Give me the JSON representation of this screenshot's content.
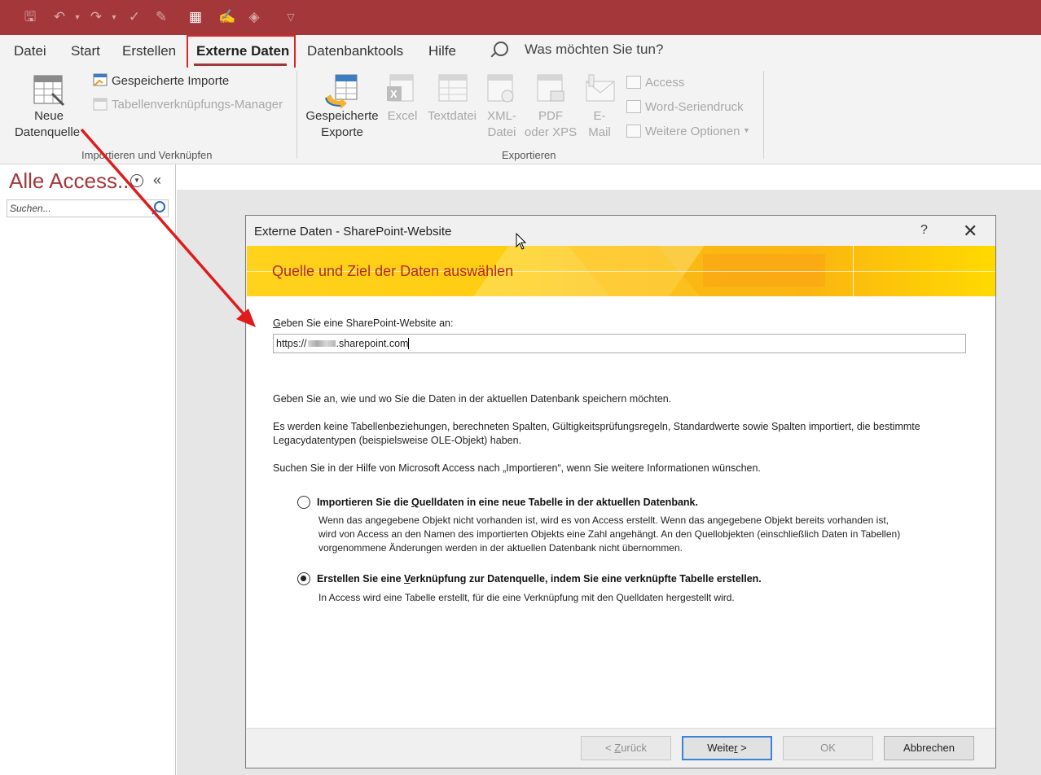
{
  "qat": {
    "icons": [
      "save-icon",
      "undo-icon",
      "redo-icon",
      "check-icon",
      "form-icon",
      "table-icon",
      "brush-icon",
      "fill-icon",
      "customize-qat-icon"
    ]
  },
  "tabs": {
    "datei": "Datei",
    "start": "Start",
    "erstellen": "Erstellen",
    "externe_daten": "Externe Daten",
    "datenbanktools": "Datenbanktools",
    "hilfe": "Hilfe",
    "tell_me": "Was möchten Sie tun?"
  },
  "ribbon": {
    "import_group": {
      "neue_datenquelle_line1": "Neue",
      "neue_datenquelle_line2": "Datenquelle",
      "gespeicherte_importe": "Gespeicherte Importe",
      "tabellenverknuepfungs_manager": "Tabellenverknüpfungs-Manager",
      "label": "Importieren und Verknüpfen"
    },
    "export_group": {
      "gespeicherte_exporte_line1": "Gespeicherte",
      "gespeicherte_exporte_line2": "Exporte",
      "excel": "Excel",
      "textdatei": "Textdatei",
      "xml_line1": "XML-",
      "xml_line2": "Datei",
      "pdf_line1": "PDF",
      "pdf_line2": "oder XPS",
      "email_line1": "E-",
      "email_line2": "Mail",
      "access": "Access",
      "word_seriendruck": "Word-Seriendruck",
      "weitere_optionen": "Weitere Optionen",
      "label": "Exportieren"
    }
  },
  "nav": {
    "title": "Alle Access...",
    "search_placeholder": "Suchen..."
  },
  "dialog": {
    "title": "Externe Daten - SharePoint-Website",
    "help": "?",
    "banner": "Quelle und Ziel der Daten auswählen",
    "site_label_prefix": "G",
    "site_label_rest": "eben Sie eine SharePoint-Website an:",
    "url_prefix": "https://",
    "url_suffix": ".sharepoint.com",
    "info1": "Geben Sie an, wie und wo Sie die Daten in der aktuellen Datenbank speichern möchten.",
    "info2_line1": "Es werden keine Tabellenbeziehungen, berechneten Spalten, Gültigkeitsprüfungsregeln, Standardwerte sowie Spalten importiert, die bestimmte",
    "info2_line2": "Legacydatentypen (beispielsweise OLE-Objekt) haben.",
    "info3": "Suchen Sie in der Hilfe von Microsoft Access nach „Importieren“, wenn Sie weitere Informationen wünschen.",
    "option_import": {
      "title_pre": "Importieren Sie die ",
      "title_ul": "Q",
      "title_post": "uelldaten in eine neue Tabelle in der aktuellen Datenbank.",
      "desc1": "Wenn das angegebene Objekt nicht vorhanden ist, wird es von Access erstellt. Wenn das angegebene Objekt bereits vorhanden ist,",
      "desc2": "wird von Access an den Namen des importierten Objekts eine Zahl angehängt. An den Quellobjekten (einschließlich Daten in Tabellen)",
      "desc3": "vorgenommene Änderungen werden in der aktuellen Datenbank nicht übernommen.",
      "selected": false
    },
    "option_link": {
      "title_pre": "Erstellen Sie eine ",
      "title_ul": "V",
      "title_post": "erknüpfung zur Datenquelle, indem Sie eine verknüpfte Tabelle erstellen.",
      "desc1": "In Access wird eine Tabelle erstellt, für die eine Verknüpfung mit den Quelldaten hergestellt wird.",
      "selected": true
    },
    "buttons": {
      "back_pre": "< ",
      "back_ul": "Z",
      "back_post": "urück",
      "next_pre": "Weite",
      "next_ul": "r",
      "next_post": " >",
      "ok": "OK",
      "cancel": "Abbrechen"
    }
  },
  "colors": {
    "accent": "#a4373a",
    "annotation": "#e01b1b",
    "banner_text": "#b32d1c"
  }
}
